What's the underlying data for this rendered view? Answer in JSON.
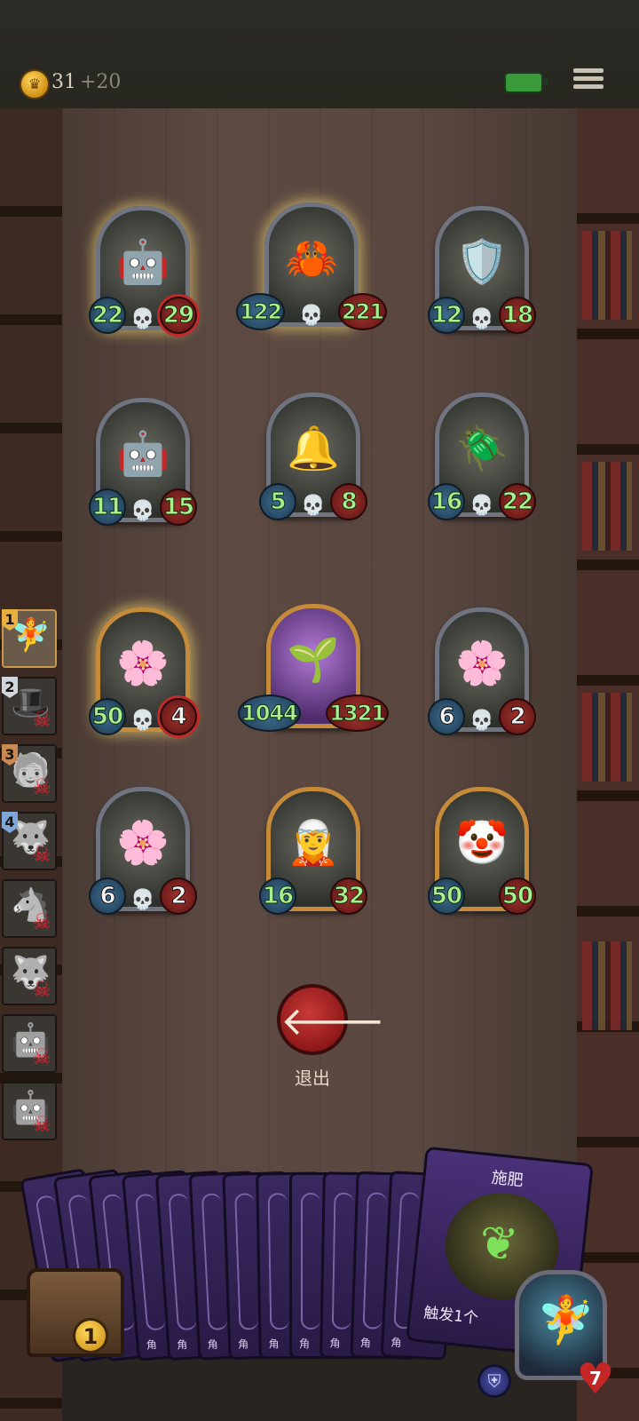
{
  "topbar": {
    "coins": "31",
    "coin_bonus": "+20"
  },
  "board": {
    "cards": [
      {
        "emoji": "🤖",
        "atk": "22",
        "hp": "29"
      },
      {
        "emoji": "🦀",
        "atk": "122",
        "hp": "221"
      },
      {
        "emoji": "🛡️",
        "atk": "12",
        "hp": "18"
      },
      {
        "emoji": "🤖",
        "atk": "11",
        "hp": "15"
      },
      {
        "emoji": "🔔",
        "atk": "5",
        "hp": "8"
      },
      {
        "emoji": "🪲",
        "atk": "16",
        "hp": "22"
      },
      {
        "emoji": "🌸",
        "atk": "50",
        "hp": "4"
      },
      {
        "emoji": "🌱",
        "atk": "1044",
        "hp": "1321"
      },
      {
        "emoji": "🌸",
        "atk": "6",
        "hp": "2"
      },
      {
        "emoji": "🌸",
        "atk": "6",
        "hp": "2"
      },
      {
        "emoji": "🧝",
        "atk": "16",
        "hp": "32"
      },
      {
        "emoji": "🤡",
        "atk": "50",
        "hp": "50"
      }
    ],
    "skull": "💀"
  },
  "turn_order": {
    "numbers": [
      "1",
      "2",
      "3",
      "4"
    ],
    "faces": [
      "🧚",
      "🎩",
      "🧓",
      "🐺",
      "🐴",
      "🐺",
      "🤖",
      "🤖"
    ],
    "skull": "☠"
  },
  "exit": {
    "icon": "🡐",
    "label": "退出"
  },
  "hand": {
    "small_glyph": "角",
    "big_card_title": "施肥",
    "big_card_trigger": "触发1个"
  },
  "chest": {
    "count": "1"
  },
  "hero": {
    "face": "🧚",
    "hp": "7",
    "shield_icon": "⛨"
  }
}
